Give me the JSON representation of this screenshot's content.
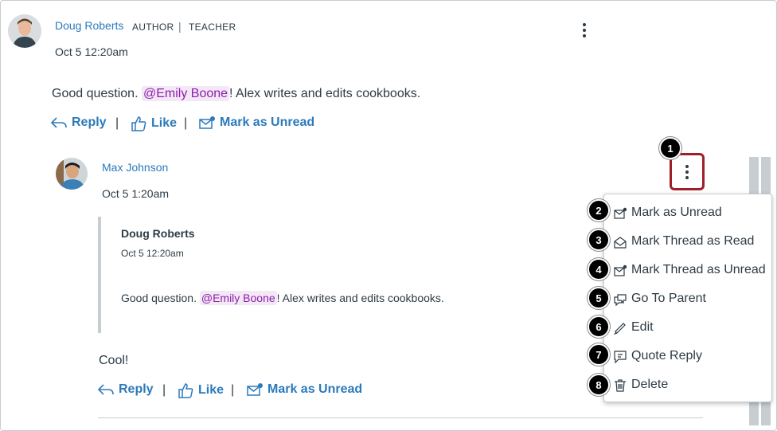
{
  "entry": {
    "author": "Doug Roberts",
    "role_author": "AUTHOR",
    "role_divider": "|",
    "role_teacher": "TEACHER",
    "date": "Oct 5 12:20am",
    "text_before": "Good question.",
    "mention": "@Emily Boone",
    "text_after": "! Alex writes and edits cookbooks.",
    "actions": {
      "reply": "Reply",
      "like": "Like",
      "mark_unread": "Mark as Unread",
      "divider": "|"
    }
  },
  "reply": {
    "author": "Max Johnson",
    "date": "Oct 5 1:20am",
    "quote": {
      "author": "Doug Roberts",
      "date": "Oct 5 12:20am",
      "text_before": "Good question.",
      "mention": "@Emily Boone",
      "text_after": "! Alex writes and edits cookbooks."
    },
    "text": "Cool!",
    "actions": {
      "reply": "Reply",
      "like": "Like",
      "mark_unread": "Mark as Unread",
      "divider": "|"
    }
  },
  "menu": {
    "items": [
      {
        "label": "Mark as Unread",
        "icon": "mail-unread-icon",
        "badge": "2"
      },
      {
        "label": "Mark Thread as Read",
        "icon": "mail-open-icon",
        "badge": "3"
      },
      {
        "label": "Mark Thread as Unread",
        "icon": "mail-unread-icon",
        "badge": "4"
      },
      {
        "label": "Go To Parent",
        "icon": "discussion-icon",
        "badge": "5"
      },
      {
        "label": "Edit",
        "icon": "pencil-icon",
        "badge": "6"
      },
      {
        "label": "Quote Reply",
        "icon": "quote-icon",
        "badge": "7"
      },
      {
        "label": "Delete",
        "icon": "trash-icon",
        "badge": "8"
      }
    ]
  },
  "callout_badge": "1",
  "colors": {
    "link": "#2b7abc",
    "mention_bg": "#f4e8f7",
    "mention_text": "#8b1fa9",
    "highlight": "#9e1f27"
  }
}
